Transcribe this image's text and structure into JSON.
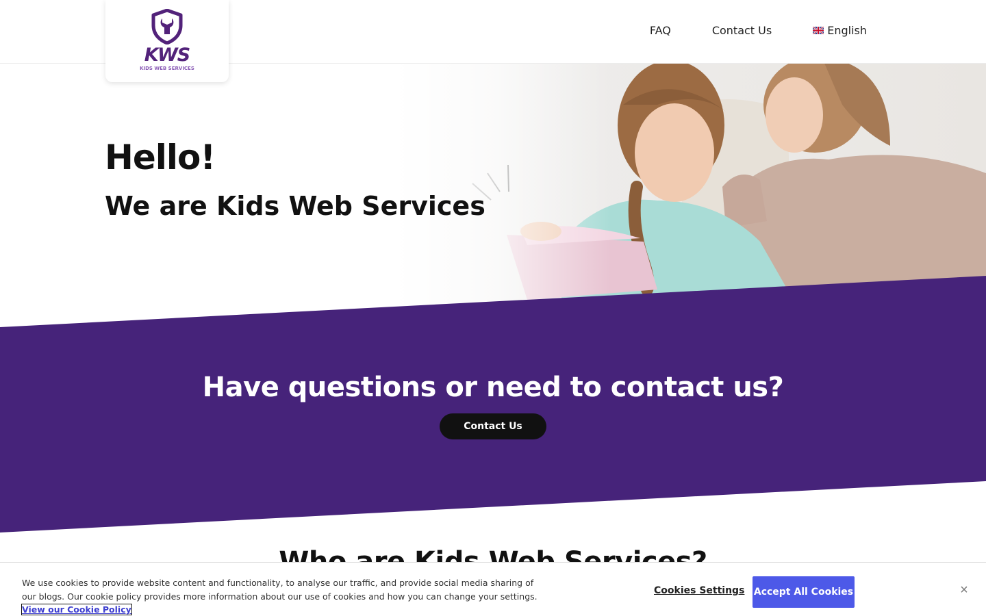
{
  "header": {
    "logo_text": "KWS",
    "logo_subtext": "KIDS WEB SERVICES",
    "nav": {
      "faq": "FAQ",
      "contact": "Contact Us",
      "language": "English"
    }
  },
  "hero": {
    "title": "Hello!",
    "subtitle": "We are Kids Web Services"
  },
  "band": {
    "title": "Have questions or need to contact us?",
    "button": "Contact Us"
  },
  "who": {
    "title": "Who are Kids Web Services?"
  },
  "cookie": {
    "text": "We use cookies to provide website content and functionality, to analyse our traffic, and provide social media sharing of our blogs. Our cookie policy provides more information about our use of cookies and how you can change your settings. ",
    "link": "View our Cookie Policy",
    "settings": "Cookies Settings",
    "accept": "Accept All Cookies",
    "close": "×"
  },
  "colors": {
    "brand_purple": "#46237a",
    "accept_blue": "#4d59e8",
    "dark_button": "#111111"
  },
  "icons": [
    "shield-wrench-icon",
    "uk-flag-icon",
    "close-icon"
  ]
}
